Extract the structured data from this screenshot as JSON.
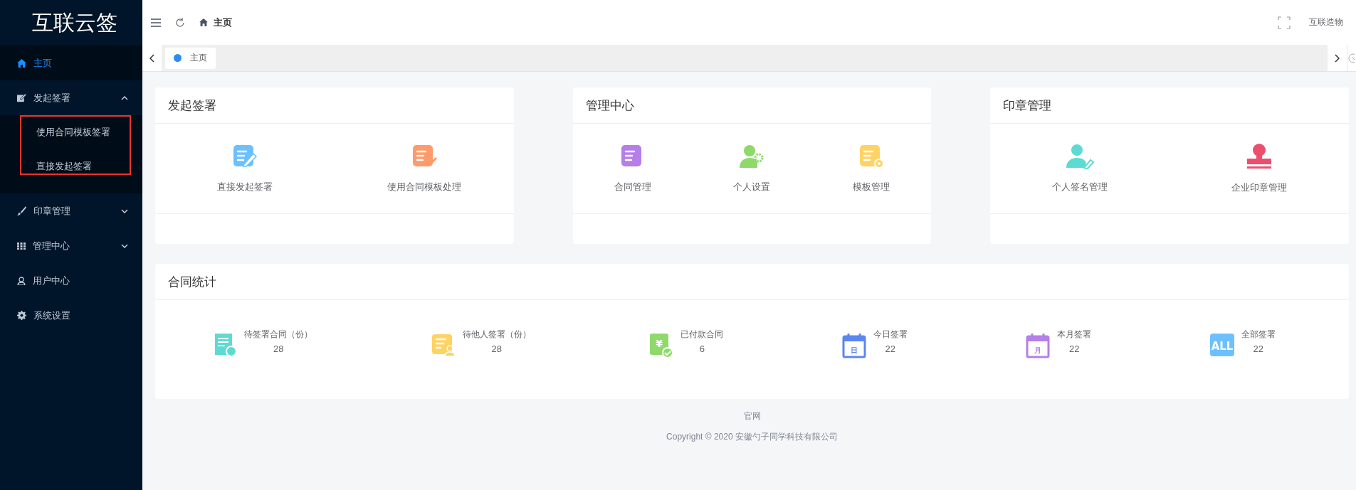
{
  "sidebar": {
    "logo": "互联云签",
    "items": [
      {
        "kind": "link",
        "label": "主页",
        "selected": true
      },
      {
        "kind": "submenu",
        "label": "发起签署",
        "expanded": true,
        "children": [
          {
            "label": "使用合同模板签署",
            "selected": false
          },
          {
            "label": "直接发起签署",
            "selected": false
          }
        ]
      },
      {
        "kind": "submenu",
        "label": "印章管理",
        "expanded": false
      },
      {
        "kind": "submenu",
        "label": "管理中心",
        "expanded": false
      },
      {
        "kind": "link",
        "label": "用户中心",
        "selected": false
      },
      {
        "kind": "link",
        "label": "系统设置",
        "selected": false
      }
    ]
  },
  "header": {
    "breadcrumb": "主页",
    "user": "互联造物"
  },
  "tabs": [
    {
      "label": "主页",
      "selected": true
    }
  ],
  "cards": [
    {
      "title": "发起签署",
      "items": [
        "直接发起签署",
        "使用合同模板处理"
      ]
    },
    {
      "title": "管理中心",
      "items": [
        "合同管理",
        "个人设置",
        "模板管理"
      ]
    },
    {
      "title": "印章管理",
      "items": [
        "个人签名管理",
        "企业印章管理"
      ]
    }
  ],
  "stats": {
    "title": "合同统计",
    "items": [
      {
        "label": "待签署合同（份）",
        "value": "28"
      },
      {
        "label": "待他人签署（份）",
        "value": "28"
      },
      {
        "label": "已付款合同",
        "value": "6",
        "icon_text": "¥"
      },
      {
        "label": "今日签署",
        "value": "22",
        "icon_text": "日"
      },
      {
        "label": "本月签署",
        "value": "22",
        "icon_text": "月"
      },
      {
        "label": "全部签署",
        "value": "22",
        "icon_text": "ALL"
      }
    ]
  },
  "footer": {
    "link": "官网",
    "copyright": "Copyright © 2020 安徽勺子同学科技有限公司"
  }
}
